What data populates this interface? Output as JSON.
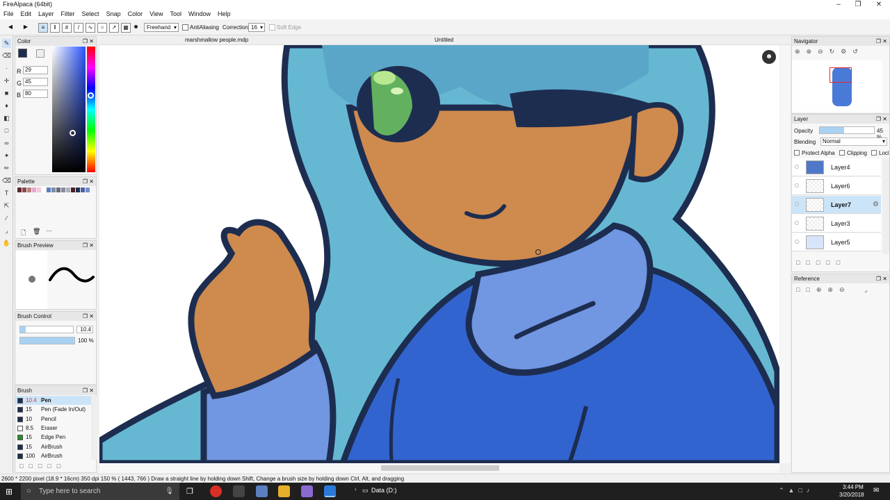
{
  "window": {
    "title": "FireAlpaca (64bit)"
  },
  "menu": [
    "File",
    "Edit",
    "Layer",
    "Filter",
    "Select",
    "Snap",
    "Color",
    "View",
    "Tool",
    "Window",
    "Help"
  ],
  "toolbar": {
    "stroke_mode": "Freehand",
    "antialiasing": "AntiAliasing",
    "correction_label": "Correction",
    "correction_value": "16",
    "soft_edge": "Soft Edge"
  },
  "tabs": {
    "left": "marshmallow people.mdp",
    "right": "Untitled"
  },
  "color": {
    "title": "Color",
    "r_label": "R",
    "r": "29",
    "g_label": "G",
    "g": "45",
    "b_label": "B",
    "b": "80",
    "primary": "#1d2d50"
  },
  "palette": {
    "title": "Palette",
    "swatches": [
      "#5a2a2a",
      "#8a4a4a",
      "#c08080",
      "#e7a8c8",
      "#f2c8e0",
      "#ffffff",
      "#5b7fbf",
      "#7a8fa8",
      "#6b6b7a",
      "#8a8a9a",
      "#aab0c0",
      "#4a2020",
      "#1d2d50",
      "#5060a0",
      "#7090d0"
    ]
  },
  "brush_preview": {
    "title": "Brush Preview"
  },
  "brush_control": {
    "title": "Brush Control",
    "size": "10.4",
    "opacity": "100 %",
    "size_fraction": 0.1,
    "opacity_fraction": 1.0
  },
  "brush": {
    "title": "Brush",
    "items": [
      {
        "size": "10.4",
        "name": "Pen",
        "color": "#1d2d50"
      },
      {
        "size": "15",
        "name": "Pen (Fade In/Out)",
        "color": "#1d2d50"
      },
      {
        "size": "10",
        "name": "Pencil",
        "color": "#1d2d50"
      },
      {
        "size": "8.5",
        "name": "Eraser",
        "color": "#ffffff"
      },
      {
        "size": "15",
        "name": "Edge Pen",
        "color": "#2a8a2a"
      },
      {
        "size": "15",
        "name": "AirBrush",
        "color": "#1d2d50"
      },
      {
        "size": "100",
        "name": "AirBrush",
        "color": "#1d2d50"
      }
    ]
  },
  "navigator": {
    "title": "Navigator"
  },
  "layer_panel": {
    "title": "Layer",
    "opacity_label": "Opacity",
    "opacity": "45 %",
    "opacity_fraction": 0.45,
    "blending_label": "Blending",
    "blending": "Normal",
    "protect_alpha": "Protect Alpha",
    "clipping": "Clipping",
    "lock": "Lock",
    "layers": [
      "Layer4",
      "Layer6",
      "Layer7",
      "Layer3",
      "Layer5"
    ],
    "selected": "Layer7"
  },
  "reference": {
    "title": "Reference"
  },
  "status": {
    "text": "2600 * 2200 pixel  (18.9 * 16cm)  350 dpi  150 %  ( 1443, 766 )  Draw a straight line by holding down Shift, Change a brush size by holding down Ctrl, Alt, and dragging"
  },
  "taskbar": {
    "search": "Type here to search",
    "drive": "Data (D:)",
    "time": "3:44 PM",
    "date": "3/20/2018"
  }
}
